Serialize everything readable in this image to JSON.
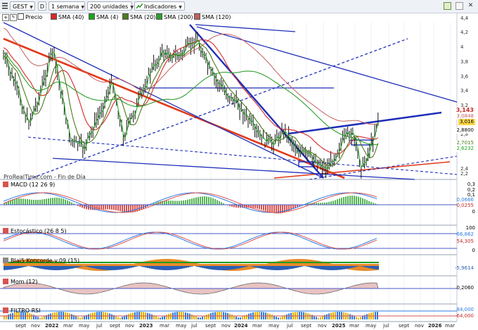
{
  "toolbar": {
    "symbol": "GEST",
    "mode": "D",
    "timeframe": "1 semana",
    "units": "200 unidades",
    "indicators": "Indicadores"
  },
  "legend": [
    {
      "label": "Precio",
      "color": "#ffffff"
    },
    {
      "label": "SMA (40)",
      "color": "#d42a2a"
    },
    {
      "label": "SMA (4)",
      "color": "#1aa51a"
    },
    {
      "label": "SMA (20)",
      "color": "#4d7a1c"
    },
    {
      "label": "SMA (200)",
      "color": "#2e9e2e"
    },
    {
      "label": "SMA (120)",
      "color": "#c46060"
    }
  ],
  "price_axis": [
    "4,4",
    "4,2",
    "4",
    "3,8",
    "3,6",
    "3,4",
    "3,2",
    "3",
    "2,8",
    "2,6",
    "2,4",
    "2,2"
  ],
  "price_badges": [
    {
      "label": "3,143",
      "color": "#c62828",
      "bg": "#ffffff"
    },
    {
      "label": "3,0848",
      "color": "#c46060",
      "bg": "#ffffff"
    },
    {
      "label": "3,016",
      "color": "#000000",
      "bg": "#ffd84a"
    },
    {
      "label": "2,8800",
      "color": "#000000",
      "bg": "#ffffff"
    },
    {
      "label": "2,7015",
      "color": "#4d7a1c",
      "bg": "#ffffff"
    },
    {
      "label": "2,6232",
      "color": "#1aa51a",
      "bg": "#ffffff"
    }
  ],
  "watermark": "ProRealTime.com - Fin de Día",
  "panels": [
    {
      "label": "MACD (12 26 9)",
      "scale": [
        "0,3",
        "0,2",
        "0,1",
        "0"
      ],
      "values": [
        "0,0666",
        "0,0255"
      ]
    },
    {
      "label": "Estocástico (26 8 5)",
      "scale": [
        "100",
        "0"
      ],
      "values": [
        "66,862",
        "54,305"
      ]
    },
    {
      "label": "Blai5 Koncorde v.09 (15)",
      "scale": [],
      "values": [
        "-5,9614"
      ]
    },
    {
      "label": "Mom (12)",
      "scale": [],
      "values": [
        "0,2060"
      ]
    },
    {
      "label": "FILTRO RSI",
      "scale": [],
      "values": [
        "84,000",
        "64,000"
      ]
    }
  ],
  "x_axis": [
    {
      "label": "sept",
      "bold": false
    },
    {
      "label": "nov",
      "bold": false
    },
    {
      "label": "2022",
      "bold": true
    },
    {
      "label": "mar",
      "bold": false
    },
    {
      "label": "may",
      "bold": false
    },
    {
      "label": "jul",
      "bold": false
    },
    {
      "label": "sept",
      "bold": false
    },
    {
      "label": "nov",
      "bold": false
    },
    {
      "label": "2023",
      "bold": true
    },
    {
      "label": "mar",
      "bold": false
    },
    {
      "label": "may",
      "bold": false
    },
    {
      "label": "jul",
      "bold": false
    },
    {
      "label": "sept",
      "bold": false
    },
    {
      "label": "nov",
      "bold": false
    },
    {
      "label": "2024",
      "bold": true
    },
    {
      "label": "mar",
      "bold": false
    },
    {
      "label": "may",
      "bold": false
    },
    {
      "label": "jul",
      "bold": false
    },
    {
      "label": "sept",
      "bold": false
    },
    {
      "label": "nov",
      "bold": false
    },
    {
      "label": "2025",
      "bold": true
    },
    {
      "label": "mar",
      "bold": false
    },
    {
      "label": "may",
      "bold": false
    },
    {
      "label": "jul",
      "bold": false
    },
    {
      "label": "sept",
      "bold": false
    },
    {
      "label": "nov",
      "bold": false
    },
    {
      "label": "2026",
      "bold": true
    },
    {
      "label": "mar",
      "bold": false
    }
  ]
}
